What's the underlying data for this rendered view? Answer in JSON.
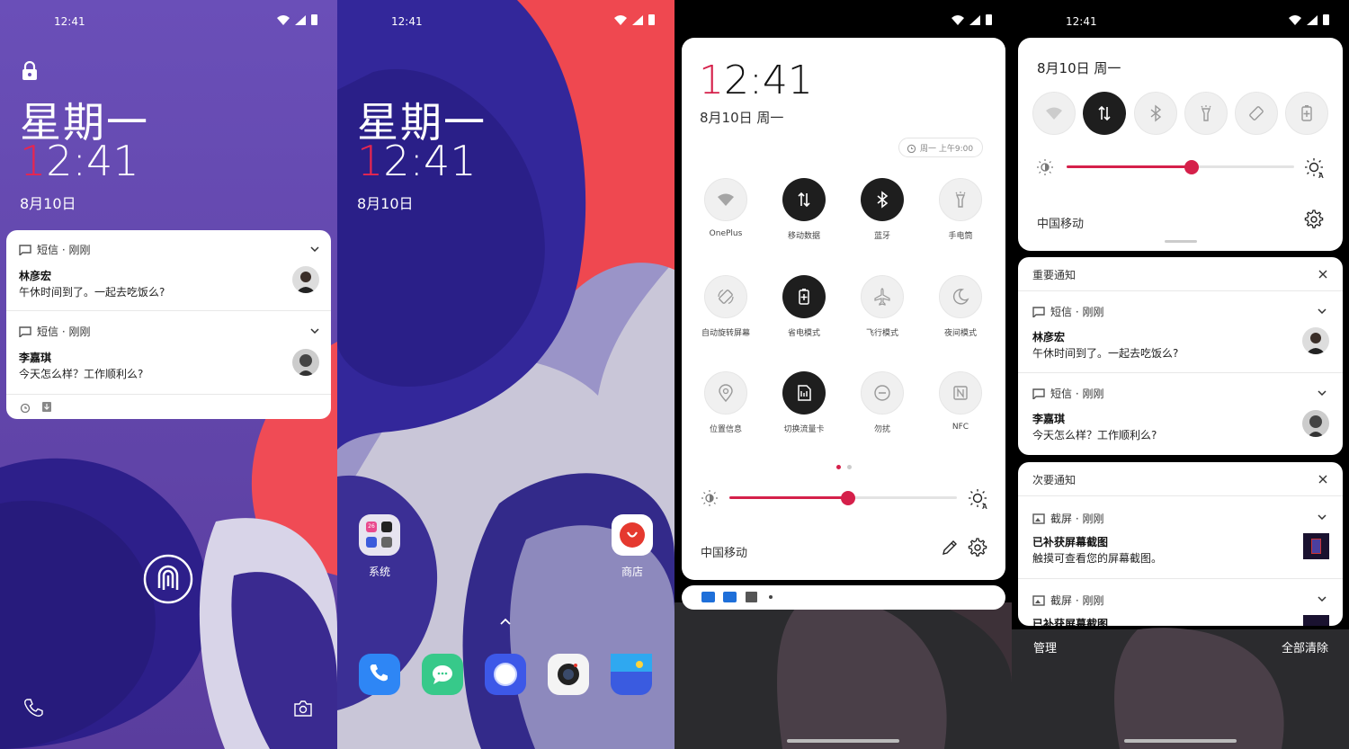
{
  "colors": {
    "accent": "#d5204a",
    "card": "#ffffff",
    "dark_toggle": "#1e1e1e"
  },
  "lock": {
    "status_time": "12:41",
    "weekday": "星期一",
    "time_first": "1",
    "time_rest": "2:41",
    "date": "8月10日",
    "notifications": [
      {
        "app": "短信 · 刚刚",
        "sender": "林彦宏",
        "message": "午休时间到了。一起去吃饭么?"
      },
      {
        "app": "短信 · 刚刚",
        "sender": "李嘉琪",
        "message": "今天怎么样？工作顺利么?"
      }
    ]
  },
  "home": {
    "status_time": "12:41",
    "weekday": "星期一",
    "time_first": "1",
    "time_rest": "2:41",
    "date": "8月10日",
    "folder_label": "系统",
    "store_label": "商店",
    "folder_badge": "26"
  },
  "quick_settings": {
    "time_first": "1",
    "time_rest": "2:41",
    "date": "8月10日 周一",
    "alarm": "周一 上午9:00",
    "tiles": [
      {
        "label": "OnePlus",
        "icon": "wifi-icon",
        "on": false
      },
      {
        "label": "移动数据",
        "icon": "mobile-data-icon",
        "on": true
      },
      {
        "label": "蓝牙",
        "icon": "bluetooth-icon",
        "on": true
      },
      {
        "label": "手电筒",
        "icon": "flashlight-icon",
        "on": false
      },
      {
        "label": "自动旋转屏幕",
        "icon": "auto-rotate-icon",
        "on": false
      },
      {
        "label": "省电模式",
        "icon": "battery-saver-icon",
        "on": true
      },
      {
        "label": "飞行模式",
        "icon": "airplane-icon",
        "on": false
      },
      {
        "label": "夜间模式",
        "icon": "night-mode-icon",
        "on": false
      },
      {
        "label": "位置信息",
        "icon": "location-icon",
        "on": false
      },
      {
        "label": "切换流量卡",
        "icon": "sim-switch-icon",
        "on": true
      },
      {
        "label": "勿扰",
        "icon": "dnd-icon",
        "on": false
      },
      {
        "label": "NFC",
        "icon": "nfc-icon",
        "on": false
      }
    ],
    "brightness": 0.52,
    "carrier": "中国移动"
  },
  "shade": {
    "status_time": "12:41",
    "date": "8月10日 周一",
    "brightness": 0.55,
    "carrier": "中国移动",
    "important_title": "重要通知",
    "secondary_title": "次要通知",
    "important": [
      {
        "app": "短信 · 刚刚",
        "sender": "林彦宏",
        "message": "午休时间到了。一起去吃饭么?"
      },
      {
        "app": "短信 · 刚刚",
        "sender": "李嘉琪",
        "message": "今天怎么样？工作顺利么?"
      }
    ],
    "secondary": [
      {
        "app": "截屏 · 刚刚",
        "title": "已补获屏幕截图",
        "message": "触摸可查看您的屏幕截图。"
      },
      {
        "app": "截屏 · 刚刚",
        "title": "已补获屏幕截图"
      }
    ],
    "manage": "管理",
    "clear_all": "全部清除"
  }
}
